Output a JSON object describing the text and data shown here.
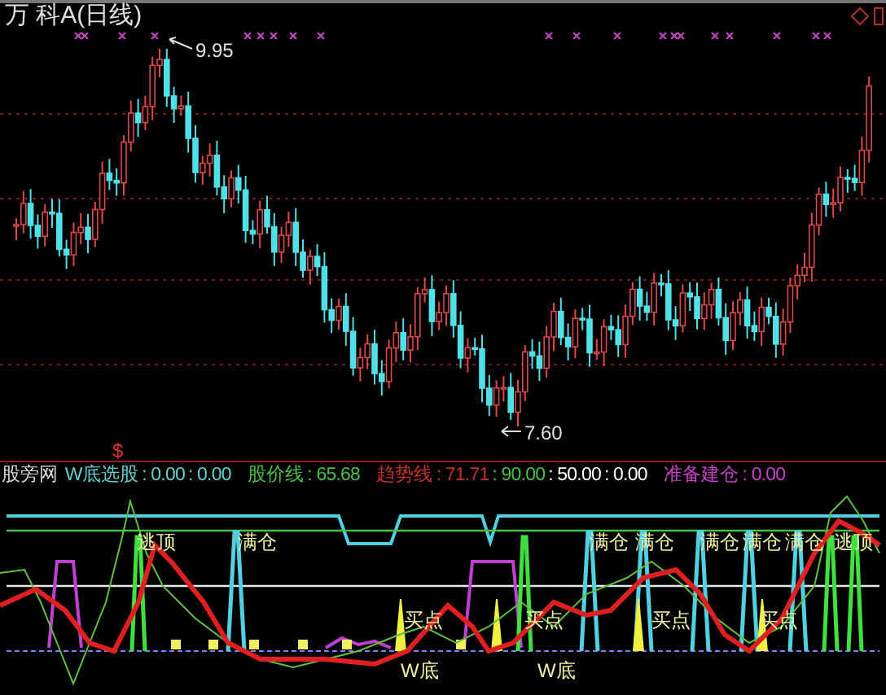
{
  "price_chart": {
    "title": "万 科A(日线)",
    "high_label": "9.95",
    "low_label": "7.60",
    "signal_mark": "$"
  },
  "indicator": {
    "name": "股旁网",
    "items": [
      {
        "label": "W底选股",
        "value": ": 0.00",
        "color": "#5fd0d0"
      },
      {
        "value": ": 0.00",
        "color": "#5fd0d0"
      },
      {
        "label": "股价线",
        "value": ": 65.68",
        "color": "#48c048"
      },
      {
        "label": "趋势线",
        "value": ": 71.71",
        "color": "#c83030"
      },
      {
        "value": ": 90.00",
        "color": "#48c048"
      },
      {
        "value": ": 50.00",
        "color": "#ffffff"
      },
      {
        "value": ": 0.00",
        "color": "#ffffff"
      },
      {
        "label": "准备建仓",
        "value": ": 0.00",
        "color": "#c840c8"
      }
    ],
    "signal_labels": [
      {
        "kind": "top",
        "text": "逃顶"
      },
      {
        "kind": "full",
        "text": "满仓"
      },
      {
        "kind": "full",
        "text": "满仓"
      },
      {
        "kind": "full",
        "text": "满仓"
      },
      {
        "kind": "full",
        "text": "满仓"
      },
      {
        "kind": "full",
        "text": "满仓"
      },
      {
        "kind": "full",
        "text": "满仓"
      },
      {
        "kind": "top",
        "text": "逃顶"
      },
      {
        "kind": "buy",
        "text": "买点"
      },
      {
        "kind": "buy",
        "text": "买点"
      },
      {
        "kind": "buy",
        "text": "买点"
      },
      {
        "kind": "buy",
        "text": "买点"
      },
      {
        "kind": "wbottom",
        "text": "W底"
      },
      {
        "kind": "wbottom",
        "text": "W底"
      }
    ]
  }
}
